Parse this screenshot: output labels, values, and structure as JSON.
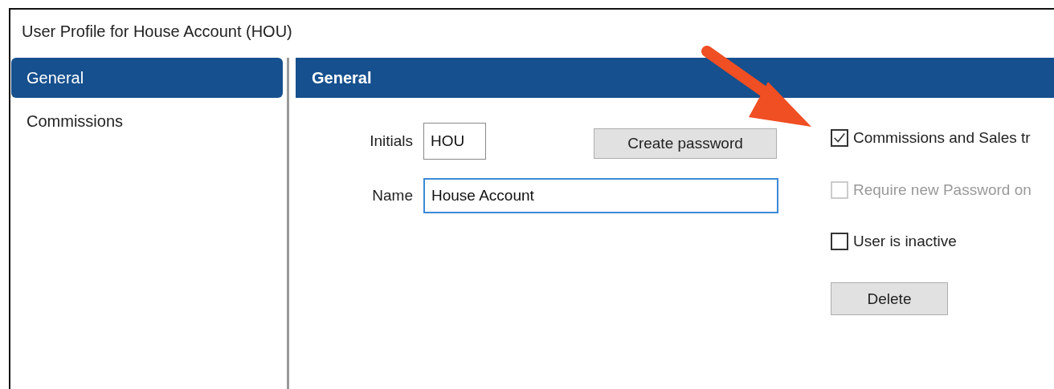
{
  "window": {
    "title": "User Profile for House Account (HOU)"
  },
  "sidebar": {
    "items": [
      {
        "label": "General",
        "selected": true
      },
      {
        "label": "Commissions",
        "selected": false
      }
    ]
  },
  "panel": {
    "title": "General",
    "initials": {
      "label": "Initials",
      "value": "HOU"
    },
    "create_password_button": "Create password",
    "name": {
      "label": "Name",
      "value": "House Account"
    },
    "checkboxes": [
      {
        "label": "Commissions and Sales tr",
        "checked": true,
        "disabled": false
      },
      {
        "label": "Require new Password on",
        "checked": false,
        "disabled": true
      },
      {
        "label": "User is inactive",
        "checked": false,
        "disabled": false
      }
    ],
    "delete_button": "Delete"
  }
}
